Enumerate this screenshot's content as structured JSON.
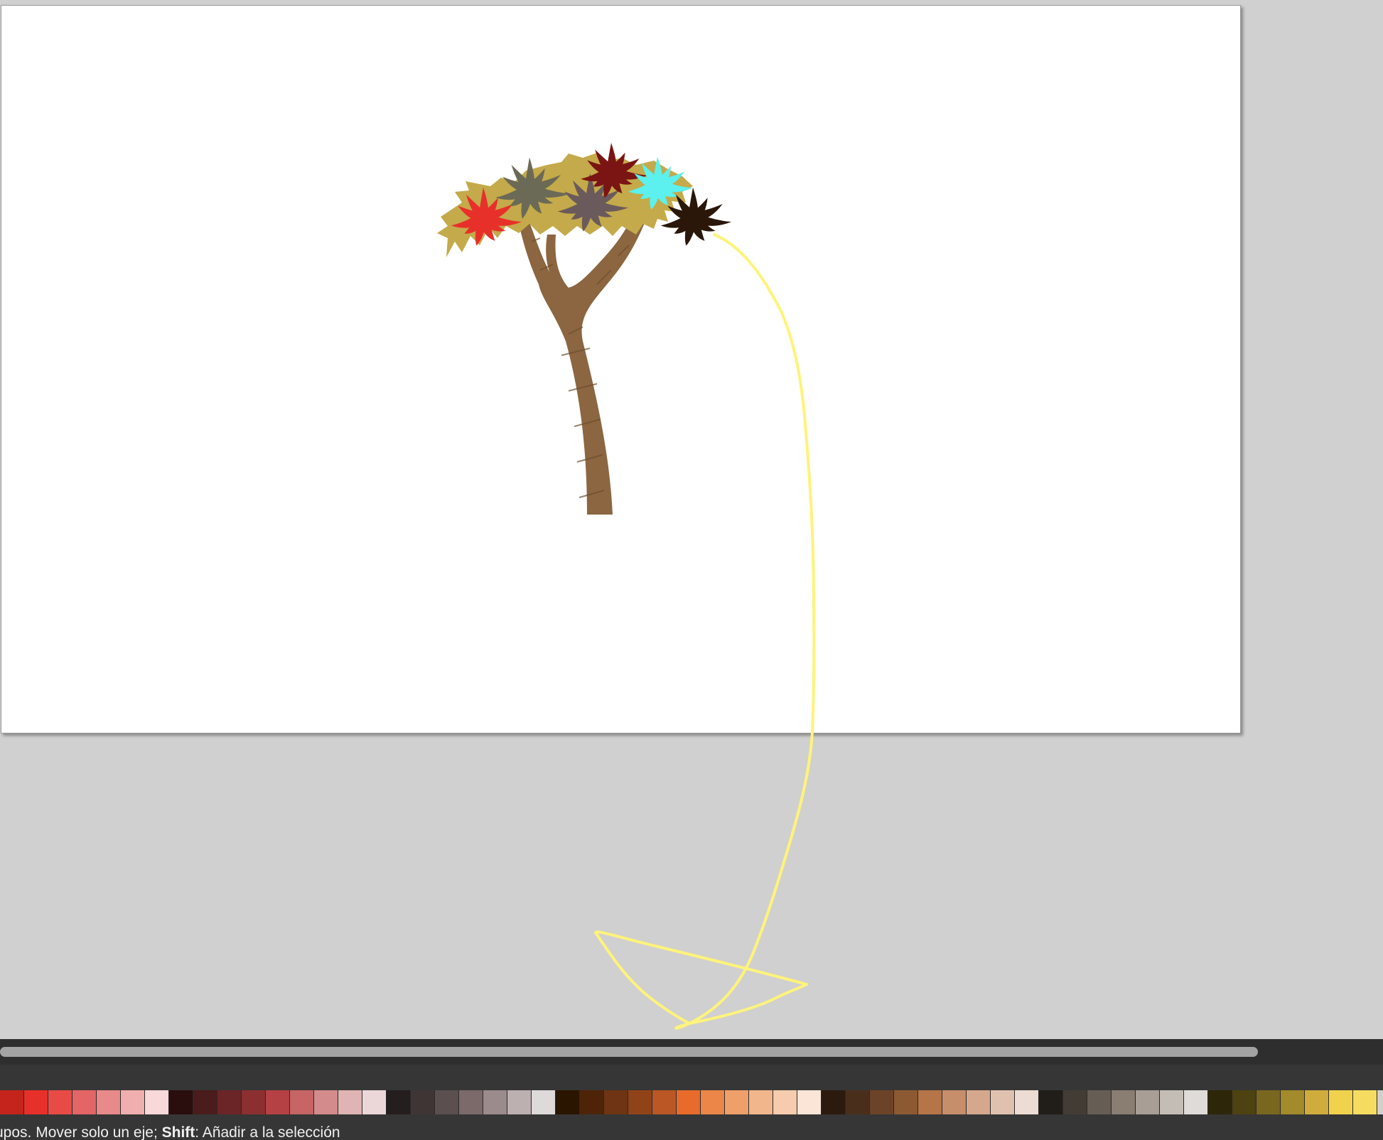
{
  "statusbar": {
    "text_before": "rupos. Mover solo un eje; ",
    "key": "Shift",
    "text_after": ": Añadir a la selección"
  },
  "palette": {
    "colors": [
      "#c5241c",
      "#e8302a",
      "#e84b45",
      "#e46566",
      "#e8898a",
      "#f1aeae",
      "#f8d8d8",
      "#2a0d0d",
      "#4a1c1c",
      "#6b2527",
      "#8b2f31",
      "#b54144",
      "#c66466",
      "#d48b8c",
      "#e0b4b4",
      "#ecd7d8",
      "#241e1e",
      "#3f3535",
      "#5c4f4f",
      "#7c6a6b",
      "#9c8b8c",
      "#bdb0b1",
      "#dedada",
      "#2a1500",
      "#4e2409",
      "#6e3413",
      "#904318",
      "#bb5725",
      "#e86b2c",
      "#ec8648",
      "#efa06a",
      "#f2b68c",
      "#f5ccae",
      "#fae5d7",
      "#2c1a0e",
      "#4a2e1c",
      "#6c4328",
      "#8d5932",
      "#b57548",
      "#c78e6c",
      "#d5a88e",
      "#e0c1b0",
      "#eddcd3",
      "#211e1a",
      "#433c35",
      "#665e55",
      "#8a7d72",
      "#a89e96",
      "#c4bdb6",
      "#dfdbd8",
      "#2e2609",
      "#4d4210",
      "#7a671f",
      "#a38a2a",
      "#cfac3c",
      "#f1d24d",
      "#f5dc61"
    ]
  },
  "drawing": {
    "trunk_color": "#8b6640",
    "foliage_color": "#c4aa4a",
    "palm_colors": [
      "#e8302a",
      "#6b6a56",
      "#6b5a5c",
      "#7a1513",
      "#5cf0ee",
      "#2a1709"
    ],
    "stroke_color": "#fff37a"
  }
}
